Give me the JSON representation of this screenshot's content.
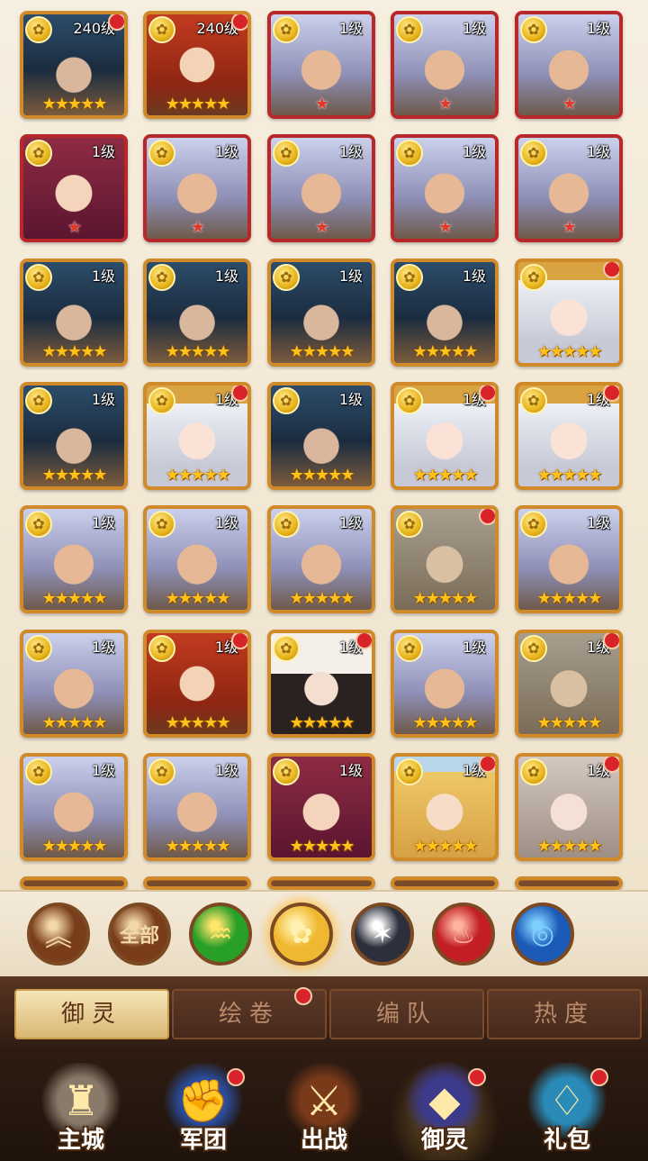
{
  "colors": {
    "card_border_gold": "#d18a2a",
    "card_border_red": "#b8282a",
    "notify_dot": "#d8232a",
    "star": "#ffc21a"
  },
  "rows": [
    [
      {
        "level": "240级",
        "stars": 5,
        "portrait": "helm",
        "dot": true,
        "border": "gold"
      },
      {
        "level": "240级",
        "stars": 5,
        "portrait": "redhair",
        "dot": true,
        "border": "gold"
      },
      {
        "level": "1级",
        "stars": 1,
        "portrait": "silver",
        "dot": false,
        "border": "red"
      },
      {
        "level": "1级",
        "stars": 1,
        "portrait": "silver",
        "dot": false,
        "border": "red"
      },
      {
        "level": "1级",
        "stars": 1,
        "portrait": "silver",
        "dot": false,
        "border": "red"
      }
    ],
    [
      {
        "level": "1级",
        "stars": 1,
        "portrait": "burgundy",
        "dot": false,
        "border": "red"
      },
      {
        "level": "1级",
        "stars": 1,
        "portrait": "silver",
        "dot": false,
        "border": "red"
      },
      {
        "level": "1级",
        "stars": 1,
        "portrait": "silver",
        "dot": false,
        "border": "red"
      },
      {
        "level": "1级",
        "stars": 1,
        "portrait": "silver",
        "dot": false,
        "border": "red"
      },
      {
        "level": "1级",
        "stars": 1,
        "portrait": "silver",
        "dot": false,
        "border": "red"
      }
    ],
    [
      {
        "level": "1级",
        "stars": 5,
        "portrait": "helm",
        "dot": false,
        "border": "gold"
      },
      {
        "level": "1级",
        "stars": 5,
        "portrait": "helm",
        "dot": false,
        "border": "gold"
      },
      {
        "level": "1级",
        "stars": 5,
        "portrait": "helm",
        "dot": false,
        "border": "gold"
      },
      {
        "level": "1级",
        "stars": 5,
        "portrait": "helm",
        "dot": false,
        "border": "gold"
      },
      {
        "level": "",
        "stars": 5,
        "portrait": "white",
        "dot": true,
        "border": "gold"
      }
    ],
    [
      {
        "level": "1级",
        "stars": 5,
        "portrait": "helm",
        "dot": false,
        "border": "gold"
      },
      {
        "level": "1级",
        "stars": 5,
        "portrait": "white",
        "dot": true,
        "border": "gold"
      },
      {
        "level": "1级",
        "stars": 5,
        "portrait": "helm",
        "dot": false,
        "border": "gold"
      },
      {
        "level": "1级",
        "stars": 5,
        "portrait": "white",
        "dot": true,
        "border": "gold"
      },
      {
        "level": "1级",
        "stars": 5,
        "portrait": "white",
        "dot": true,
        "border": "gold"
      }
    ],
    [
      {
        "level": "1级",
        "stars": 5,
        "portrait": "silver",
        "dot": false,
        "border": "gold"
      },
      {
        "level": "1级",
        "stars": 5,
        "portrait": "silver",
        "dot": false,
        "border": "gold"
      },
      {
        "level": "1级",
        "stars": 5,
        "portrait": "silver",
        "dot": false,
        "border": "gold"
      },
      {
        "level": "",
        "stars": 5,
        "portrait": "ash",
        "dot": true,
        "border": "gold"
      },
      {
        "level": "1级",
        "stars": 5,
        "portrait": "silver",
        "dot": false,
        "border": "gold"
      }
    ],
    [
      {
        "level": "1级",
        "stars": 5,
        "portrait": "silver",
        "dot": false,
        "border": "gold"
      },
      {
        "level": "1级",
        "stars": 5,
        "portrait": "redhair",
        "dot": true,
        "border": "gold"
      },
      {
        "level": "1级",
        "stars": 5,
        "portrait": "black",
        "dot": true,
        "border": "gold"
      },
      {
        "level": "1级",
        "stars": 5,
        "portrait": "silver",
        "dot": false,
        "border": "gold"
      },
      {
        "level": "1级",
        "stars": 5,
        "portrait": "ash",
        "dot": true,
        "border": "gold"
      }
    ],
    [
      {
        "level": "1级",
        "stars": 5,
        "portrait": "silver",
        "dot": false,
        "border": "gold"
      },
      {
        "level": "1级",
        "stars": 5,
        "portrait": "silver",
        "dot": false,
        "border": "gold"
      },
      {
        "level": "1级",
        "stars": 5,
        "portrait": "burgundy",
        "dot": false,
        "border": "gold"
      },
      {
        "level": "1级",
        "stars": 5,
        "portrait": "blonde",
        "dot": true,
        "border": "gold"
      },
      {
        "level": "1级",
        "stars": 5,
        "portrait": "grey",
        "dot": true,
        "border": "gold"
      }
    ]
  ],
  "filters": [
    {
      "name": "collapse",
      "label": "︽",
      "icon": "double-chevron-up-icon",
      "bg": "#7a3d1c",
      "fg": "#f3d8a8"
    },
    {
      "name": "all",
      "label": "全部",
      "icon": "",
      "bg": "#7a3d1c",
      "fg": "#f3d8a8"
    },
    {
      "name": "wind",
      "label": "",
      "icon": "wind-swirl-icon",
      "bg": "#28a028",
      "fg": "#ffe46a"
    },
    {
      "name": "rose",
      "label": "",
      "icon": "rose-icon",
      "bg": "#f0b830",
      "fg": "#fff2b0"
    },
    {
      "name": "star",
      "label": "",
      "icon": "star-emblem-icon",
      "bg": "#2d2f3c",
      "fg": "#ffffff"
    },
    {
      "name": "phoenix",
      "label": "",
      "icon": "phoenix-icon",
      "bg": "#c21e23",
      "fg": "#ffb3a0"
    },
    {
      "name": "water",
      "label": "",
      "icon": "wave-icon",
      "bg": "#1c5ab8",
      "fg": "#7fd0ff"
    }
  ],
  "tabs": [
    {
      "label": "御灵",
      "active": true,
      "dot": false
    },
    {
      "label": "绘卷",
      "active": false,
      "dot": true
    },
    {
      "label": "编队",
      "active": false,
      "dot": false
    },
    {
      "label": "热度",
      "active": false,
      "dot": false
    }
  ],
  "nav": [
    {
      "label": "主城",
      "icon": "city-statue-icon",
      "dot": false,
      "active": false
    },
    {
      "label": "军团",
      "icon": "legion-fist-shield-icon",
      "dot": true,
      "active": false
    },
    {
      "label": "出战",
      "icon": "sword-gate-icon",
      "dot": false,
      "active": false
    },
    {
      "label": "御灵",
      "icon": "crystal-icon",
      "dot": true,
      "active": true
    },
    {
      "label": "礼包",
      "icon": "treasure-chest-icon",
      "dot": true,
      "active": false
    }
  ]
}
